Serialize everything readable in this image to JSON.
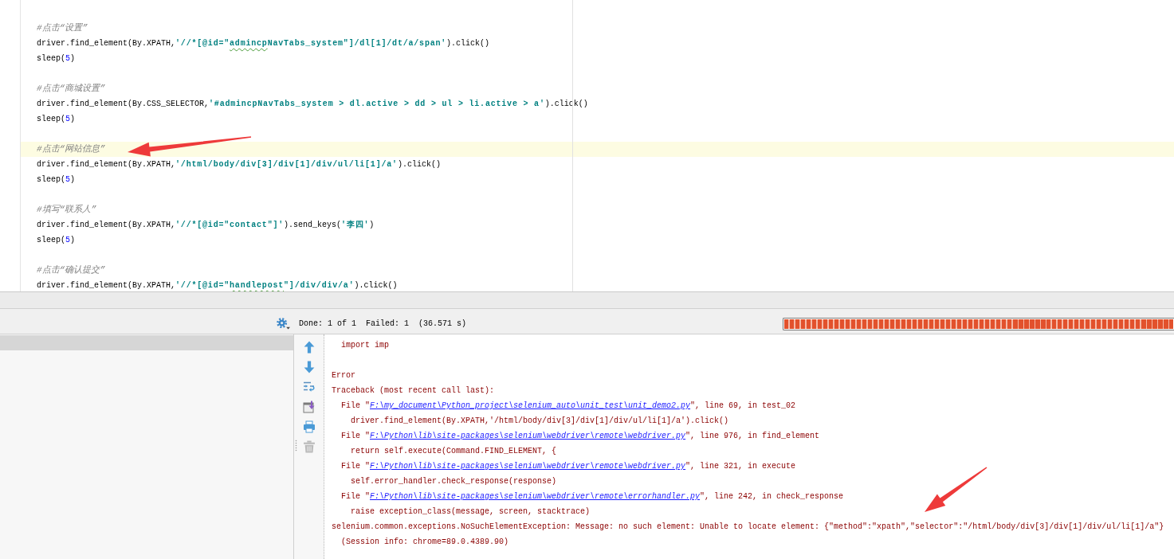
{
  "editor": {
    "lines": [
      {
        "kind": "blank",
        "current": false
      },
      {
        "kind": "code",
        "current": false,
        "tokens": [
          {
            "kind": "comment",
            "text": "#点击“设置”"
          }
        ]
      },
      {
        "kind": "code",
        "current": false,
        "tokens": [
          {
            "kind": "plain",
            "text": "driver.find_element(By.XPATH,"
          },
          {
            "kind": "string",
            "text": "'//*[@id=\""
          },
          {
            "kind": "flagged",
            "text": "admincp"
          },
          {
            "kind": "string",
            "text": "NavTabs_system\"]/dl[1]/dt/a/span'"
          },
          {
            "kind": "plain",
            "text": ").click()"
          }
        ]
      },
      {
        "kind": "code",
        "current": false,
        "tokens": [
          {
            "kind": "plain",
            "text": "sleep("
          },
          {
            "kind": "number",
            "text": "5"
          },
          {
            "kind": "plain",
            "text": ")"
          }
        ]
      },
      {
        "kind": "blank",
        "current": false
      },
      {
        "kind": "code",
        "current": false,
        "tokens": [
          {
            "kind": "comment",
            "text": "#点击“商城设置”"
          }
        ]
      },
      {
        "kind": "code",
        "current": false,
        "tokens": [
          {
            "kind": "plain",
            "text": "driver.find_element(By.CSS_SELECTOR,"
          },
          {
            "kind": "string",
            "text": "'#admincpNavTabs_system > dl.active > dd > ul > li.active > a'"
          },
          {
            "kind": "plain",
            "text": ").click()"
          }
        ]
      },
      {
        "kind": "code",
        "current": false,
        "tokens": [
          {
            "kind": "plain",
            "text": "sleep("
          },
          {
            "kind": "number",
            "text": "5"
          },
          {
            "kind": "plain",
            "text": ")"
          }
        ]
      },
      {
        "kind": "blank",
        "current": false
      },
      {
        "kind": "code",
        "current": true,
        "tokens": [
          {
            "kind": "comment",
            "text": "#点击“网站信息”"
          }
        ]
      },
      {
        "kind": "code",
        "current": false,
        "tokens": [
          {
            "kind": "plain",
            "text": "driver.find_element(By.XPATH,"
          },
          {
            "kind": "string",
            "text": "'/html/body/div[3]/div[1]/div/ul/li[1]/a'"
          },
          {
            "kind": "plain",
            "text": ").click()"
          }
        ]
      },
      {
        "kind": "code",
        "current": false,
        "tokens": [
          {
            "kind": "plain",
            "text": "sleep("
          },
          {
            "kind": "number",
            "text": "5"
          },
          {
            "kind": "plain",
            "text": ")"
          }
        ]
      },
      {
        "kind": "blank",
        "current": false
      },
      {
        "kind": "code",
        "current": false,
        "tokens": [
          {
            "kind": "comment",
            "text": "#填写“联系人”"
          }
        ]
      },
      {
        "kind": "code",
        "current": false,
        "tokens": [
          {
            "kind": "plain",
            "text": "driver.find_element(By.XPATH,"
          },
          {
            "kind": "string",
            "text": "'//*[@id=\"contact\"]'"
          },
          {
            "kind": "plain",
            "text": ").send_keys("
          },
          {
            "kind": "string",
            "text": "'李四'"
          },
          {
            "kind": "plain",
            "text": ")"
          }
        ]
      },
      {
        "kind": "code",
        "current": false,
        "tokens": [
          {
            "kind": "plain",
            "text": "sleep("
          },
          {
            "kind": "number",
            "text": "5"
          },
          {
            "kind": "plain",
            "text": ")"
          }
        ]
      },
      {
        "kind": "blank",
        "current": false
      },
      {
        "kind": "code",
        "current": false,
        "tokens": [
          {
            "kind": "comment",
            "text": "#点击“确认提交”"
          }
        ]
      },
      {
        "kind": "code",
        "current": false,
        "tokens": [
          {
            "kind": "plain",
            "text": "driver.find_element(By.XPATH,"
          },
          {
            "kind": "string",
            "text": "'//*[@id=\""
          },
          {
            "kind": "flagged",
            "text": "handlepost"
          },
          {
            "kind": "string",
            "text": "\"]/div/div/a'"
          },
          {
            "kind": "plain",
            "text": ").click()"
          }
        ]
      }
    ]
  },
  "run_panel": {
    "done": "Done: 1 of 1",
    "failed": "Failed: 1",
    "duration": "(36.571 s)",
    "progress": {
      "kind": "failed",
      "level": 1
    }
  },
  "test_tree": {
    "rows": [
      {
        "selected": true
      }
    ]
  },
  "console_toolbar": [
    {
      "kind": "arrow_up",
      "disabled": false
    },
    {
      "kind": "arrow_down",
      "disabled": false
    },
    {
      "kind": "wrap",
      "disabled": false
    },
    {
      "kind": "export",
      "disabled": false
    },
    {
      "kind": "print",
      "disabled": false
    },
    {
      "kind": "delete",
      "disabled": true
    }
  ],
  "console": {
    "lines": [
      {
        "kind": "note",
        "text": "import imp"
      },
      {
        "kind": "blank"
      },
      {
        "kind": "message",
        "text": "Error"
      },
      {
        "kind": "message",
        "text": "Traceback (most recent call last):"
      },
      {
        "kind": "frame",
        "prefix": "File \"",
        "path": "F:\\my_document\\Python_project\\selenium_auto\\unit_test\\unit_demo2.py",
        "suffix": "\", line 69, in test_02"
      },
      {
        "kind": "source",
        "text": "driver.find_element(By.XPATH,'/html/body/div[3]/div[1]/div/ul/li[1]/a').click()"
      },
      {
        "kind": "frame",
        "prefix": "File \"",
        "path": "F:\\Python\\lib\\site-packages\\selenium\\webdriver\\remote\\webdriver.py",
        "suffix": "\", line 976, in find_element"
      },
      {
        "kind": "source",
        "text": "return self.execute(Command.FIND_ELEMENT, {"
      },
      {
        "kind": "frame",
        "prefix": "File \"",
        "path": "F:\\Python\\lib\\site-packages\\selenium\\webdriver\\remote\\webdriver.py",
        "suffix": "\", line 321, in execute"
      },
      {
        "kind": "source",
        "text": "self.error_handler.check_response(response)"
      },
      {
        "kind": "frame",
        "prefix": "File \"",
        "path": "F:\\Python\\lib\\site-packages\\selenium\\webdriver\\remote\\errorhandler.py",
        "suffix": "\", line 242, in check_response"
      },
      {
        "kind": "source",
        "text": "raise exception_class(message, screen, stacktrace)"
      },
      {
        "kind": "message",
        "text": "selenium.common.exceptions.NoSuchElementException: Message: no such element: Unable to locate element: {\"method\":\"xpath\",\"selector\":\"/html/body/div[3]/div[1]/div/ul/li[1]/a\"}"
      },
      {
        "kind": "note",
        "text": "(Session info: chrome=89.0.4389.90)"
      }
    ]
  }
}
